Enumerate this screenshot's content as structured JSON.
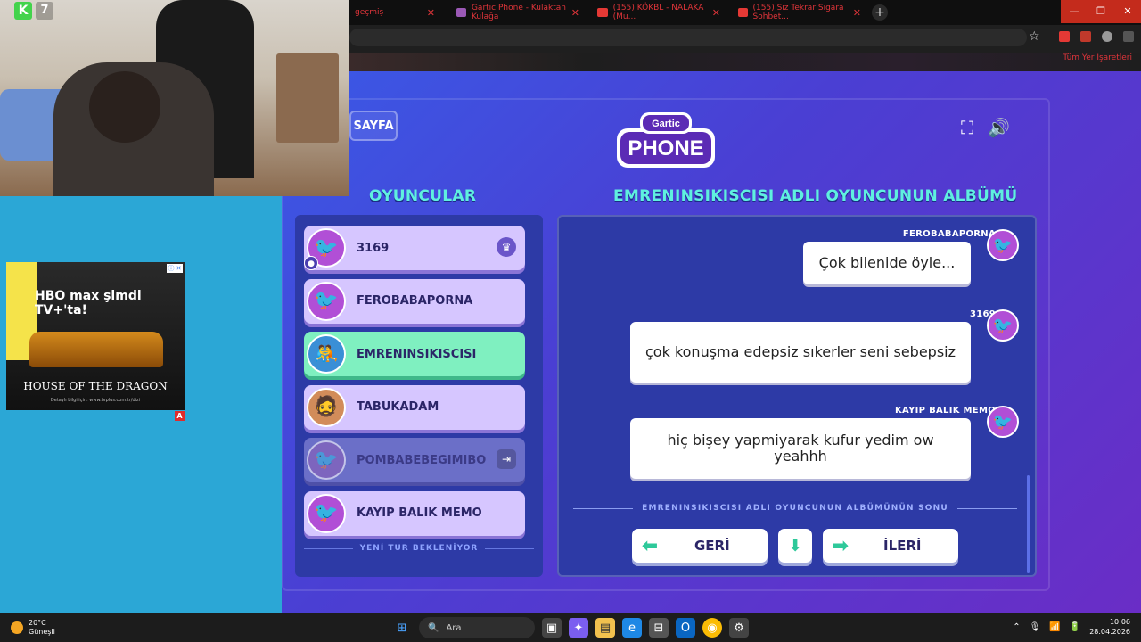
{
  "browser": {
    "tabs": [
      {
        "label": "geçmiş",
        "color": "#c0392b"
      },
      {
        "label": "Gartic Phone - Kulaktan Kulağa",
        "color": "#9b59b6"
      },
      {
        "label": "(155) KÖKBL - NALAKA (Mu...",
        "color": "#e53935"
      },
      {
        "label": "(155) Siz Tekrar Sigara Sohbet...",
        "color": "#e53935"
      }
    ],
    "bookmarks_label": "Tüm Yer İşaretleri"
  },
  "game": {
    "page_button": "SAYFA",
    "logo_top": "Gartic",
    "logo_main": "PHONE",
    "players_title": "OYUNCULAR",
    "album_title": "EMRENINSIKISCISI ADLI OYUNCUNUN ALBÜMÜ",
    "players": [
      {
        "name": "3169",
        "avatar": "🐦",
        "avatar_bg": "#b14fd6",
        "state": "host"
      },
      {
        "name": "FEROBABAPORNA",
        "avatar": "🐦",
        "avatar_bg": "#b14fd6",
        "state": "normal"
      },
      {
        "name": "EMRENINSIKISCISI",
        "avatar": "🤼",
        "avatar_bg": "#3a8fd6",
        "state": "active"
      },
      {
        "name": "TABUKADAM",
        "avatar": "🧔",
        "avatar_bg": "#d28c5a",
        "state": "normal"
      },
      {
        "name": "POMBABEBEGIMIBO",
        "avatar": "🐦",
        "avatar_bg": "#8a5fb8",
        "state": "left"
      },
      {
        "name": "KAYIP BALIK MEMO",
        "avatar": "🐦",
        "avatar_bg": "#b14fd6",
        "state": "normal"
      }
    ],
    "waiting_label": "YENİ TUR BEKLENİYOR",
    "messages": [
      {
        "author": "FEROBABAPORNA",
        "text": "Çok bilenide öyle..."
      },
      {
        "author": "3169",
        "text": "çok konuşma edepsiz sıkerler seni sebepsiz"
      },
      {
        "author": "KAYIP BALIK MEMO",
        "text": "hiç bişey yapmiyarak kufur yedim ow yeahhh"
      }
    ],
    "album_end": "EMRENINSIKISCISI ADLI OYUNCUNUN ALBÜMÜNÜN SONU",
    "back_label": "GERİ",
    "next_label": "İLERİ"
  },
  "stream": {
    "logo_letter": "K",
    "logo_num": "7"
  },
  "ad": {
    "headline": "HBO max şimdi TV+'ta!",
    "title": "HOUSE OF THE DRAGON",
    "small": "Detaylı bilgi için: www.tvplus.com.tr/dizi",
    "mark": "A"
  },
  "taskbar": {
    "temperature": "20°C",
    "weather_desc": "Güneşli",
    "search_placeholder": "Ara",
    "time": "10:06",
    "date": "28.04.2026"
  }
}
